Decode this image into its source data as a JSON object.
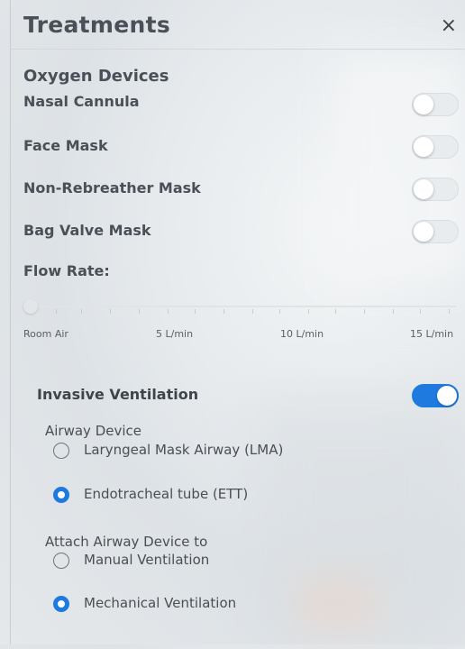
{
  "panel": {
    "title": "Treatments",
    "close_label": "×"
  },
  "oxygen": {
    "section_title": "Oxygen Devices",
    "devices": [
      {
        "label": "Nasal Cannula",
        "enabled": false
      },
      {
        "label": "Face Mask",
        "enabled": false
      },
      {
        "label": "Non-Rebreather Mask",
        "enabled": false
      },
      {
        "label": "Bag Valve Mask",
        "enabled": false
      }
    ]
  },
  "flow": {
    "label": "Flow Rate:",
    "value_l_per_min": 0,
    "min_l_per_min": 0,
    "max_l_per_min": 15,
    "scale_labels": [
      "Room Air",
      "5 L/min",
      "10 L/min",
      "15 L/min"
    ]
  },
  "invasive": {
    "label": "Invasive Ventilation",
    "enabled": true,
    "airway_device": {
      "label": "Airway Device",
      "options": [
        {
          "label": "Laryngeal Mask Airway (LMA)",
          "selected": false
        },
        {
          "label": "Endotracheal tube (ETT)",
          "selected": true
        }
      ]
    },
    "attach_to": {
      "label": "Attach Airway Device to",
      "options": [
        {
          "label": "Manual Ventilation",
          "selected": false
        },
        {
          "label": "Mechanical Ventilation",
          "selected": true
        }
      ]
    }
  },
  "colors": {
    "accent": "#1f7ae0",
    "text": "#4a5057",
    "toggle_off": "#e9ecef"
  }
}
